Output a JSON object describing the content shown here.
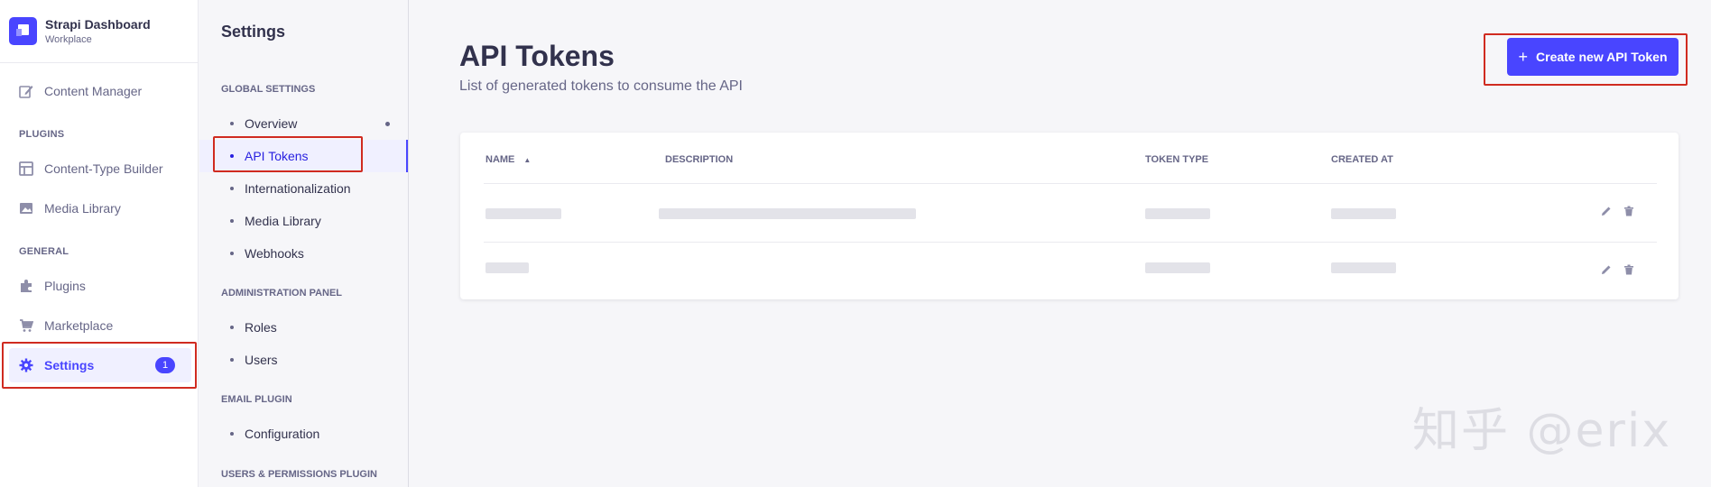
{
  "brand": {
    "title": "Strapi Dashboard",
    "workspace": "Workplace"
  },
  "mainnav": {
    "content_manager": "Content Manager",
    "plugins_section": "PLUGINS",
    "content_type_builder": "Content-Type Builder",
    "media_library": "Media Library",
    "general_section": "GENERAL",
    "plugins": "Plugins",
    "marketplace": "Marketplace",
    "settings": "Settings",
    "settings_badge": "1"
  },
  "subnav": {
    "title": "Settings",
    "global_section": "GLOBAL SETTINGS",
    "overview": "Overview",
    "api_tokens": "API Tokens",
    "internationalization": "Internationalization",
    "media_library": "Media Library",
    "webhooks": "Webhooks",
    "admin_section": "ADMINISTRATION PANEL",
    "roles": "Roles",
    "users": "Users",
    "email_section": "EMAIL PLUGIN",
    "configuration": "Configuration",
    "users_permissions_section": "USERS & PERMISSIONS PLUGIN"
  },
  "main": {
    "title": "API Tokens",
    "subtitle": "List of generated tokens to consume the API",
    "create_button": "Create new API Token"
  },
  "table": {
    "columns": [
      "NAME",
      "DESCRIPTION",
      "TOKEN TYPE",
      "CREATED AT"
    ],
    "rows": [
      {
        "name": "",
        "description": "",
        "token_type": "",
        "created_at": ""
      },
      {
        "name": "",
        "description": "",
        "token_type": "",
        "created_at": ""
      }
    ]
  },
  "watermark": "知乎 @erix",
  "colors": {
    "primary": "#4945ff",
    "highlight": "#d02b20",
    "text": "#32324d",
    "muted": "#666687"
  }
}
